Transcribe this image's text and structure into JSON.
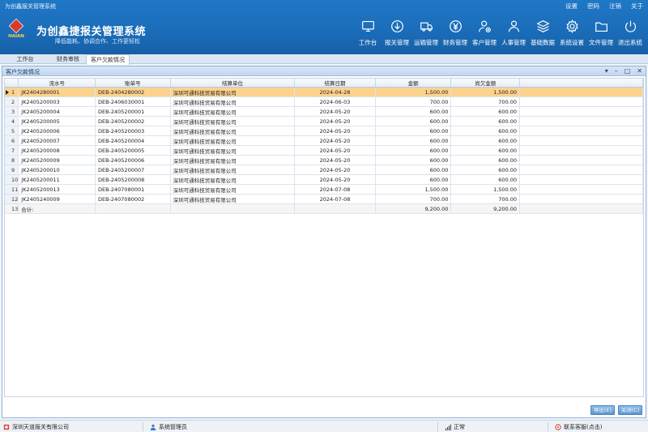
{
  "app": {
    "window_title": "为创鑫报关管理系统",
    "brand": "为创鑫捷报关管理系统",
    "slogan": "降低能耗、协调合作、工作更轻松",
    "logo_text": "HAIAN"
  },
  "top_links": [
    "设置",
    "密码",
    "注销",
    "关于"
  ],
  "nav": [
    {
      "label": "工作台",
      "icon": "monitor-icon"
    },
    {
      "label": "报关管理",
      "icon": "customs-icon"
    },
    {
      "label": "运输管理",
      "icon": "truck-icon"
    },
    {
      "label": "财务管理",
      "icon": "yen-icon"
    },
    {
      "label": "客户管理",
      "icon": "customer-icon"
    },
    {
      "label": "人事管理",
      "icon": "personnel-icon"
    },
    {
      "label": "基础数据",
      "icon": "layers-icon"
    },
    {
      "label": "系统设置",
      "icon": "gear-icon"
    },
    {
      "label": "文件管理",
      "icon": "folder-icon"
    },
    {
      "label": "退出系统",
      "icon": "power-icon"
    }
  ],
  "tabs": [
    {
      "label": "工作台"
    },
    {
      "label": "财务审核"
    },
    {
      "label": "客户欠款情况"
    }
  ],
  "window": {
    "title": "客户欠款情况",
    "controls": [
      "▾",
      "–",
      "□",
      "✕"
    ]
  },
  "table": {
    "columns": [
      "流水号",
      "账单号",
      "结算单位",
      "结算日期",
      "金额",
      "尚欠金额"
    ],
    "rows": [
      {
        "idx": "1",
        "serial": "JK2404280001",
        "bill": "DEB-2404280002",
        "unit": "深圳可通科技贸易有限公司",
        "date": "2024-04-28",
        "amount": "1,500.00",
        "owed": "1,500.00"
      },
      {
        "idx": "2",
        "serial": "JK2405200003",
        "bill": "DEB-2406030001",
        "unit": "深圳可通科技贸易有限公司",
        "date": "2024-06-03",
        "amount": "700.00",
        "owed": "700.00"
      },
      {
        "idx": "3",
        "serial": "JK2405200004",
        "bill": "DEB-2405200001",
        "unit": "深圳可通科技贸易有限公司",
        "date": "2024-05-20",
        "amount": "600.00",
        "owed": "600.00"
      },
      {
        "idx": "4",
        "serial": "JK2405200005",
        "bill": "DEB-2405200002",
        "unit": "深圳可通科技贸易有限公司",
        "date": "2024-05-20",
        "amount": "600.00",
        "owed": "600.00"
      },
      {
        "idx": "5",
        "serial": "JK2405200006",
        "bill": "DEB-2405200003",
        "unit": "深圳可通科技贸易有限公司",
        "date": "2024-05-20",
        "amount": "600.00",
        "owed": "600.00"
      },
      {
        "idx": "6",
        "serial": "JK2405200007",
        "bill": "DEB-2405200004",
        "unit": "深圳可通科技贸易有限公司",
        "date": "2024-05-20",
        "amount": "600.00",
        "owed": "600.00"
      },
      {
        "idx": "7",
        "serial": "JK2405200008",
        "bill": "DEB-2405200005",
        "unit": "深圳可通科技贸易有限公司",
        "date": "2024-05-20",
        "amount": "600.00",
        "owed": "600.00"
      },
      {
        "idx": "8",
        "serial": "JK2405200009",
        "bill": "DEB-2405200006",
        "unit": "深圳可通科技贸易有限公司",
        "date": "2024-05-20",
        "amount": "600.00",
        "owed": "600.00"
      },
      {
        "idx": "9",
        "serial": "JK2405200010",
        "bill": "DEB-2405200007",
        "unit": "深圳可通科技贸易有限公司",
        "date": "2024-05-20",
        "amount": "600.00",
        "owed": "600.00"
      },
      {
        "idx": "10",
        "serial": "JK2405200011",
        "bill": "DEB-2405200008",
        "unit": "深圳可通科技贸易有限公司",
        "date": "2024-05-20",
        "amount": "600.00",
        "owed": "600.00"
      },
      {
        "idx": "11",
        "serial": "JK2405200013",
        "bill": "DEB-2407080001",
        "unit": "深圳可通科技贸易有限公司",
        "date": "2024-07-08",
        "amount": "1,500.00",
        "owed": "1,500.00"
      },
      {
        "idx": "12",
        "serial": "JK2405240009",
        "bill": "DEB-2407080002",
        "unit": "深圳可通科技贸易有限公司",
        "date": "2024-07-08",
        "amount": "700.00",
        "owed": "700.00"
      }
    ],
    "total": {
      "idx": "13",
      "label": "合计:",
      "amount": "9,200.00",
      "owed": "9,200.00"
    }
  },
  "buttons": {
    "export": "导出(E)",
    "close": "关闭(C)"
  },
  "status": {
    "company": "深圳天道报关有限公司",
    "user": "系统管理员",
    "network": "正常",
    "support": "联系客服(点击)"
  },
  "colors": {
    "header": "#1a6cb8",
    "selected_row": "#fbd28f",
    "button": "#5b95d0"
  }
}
